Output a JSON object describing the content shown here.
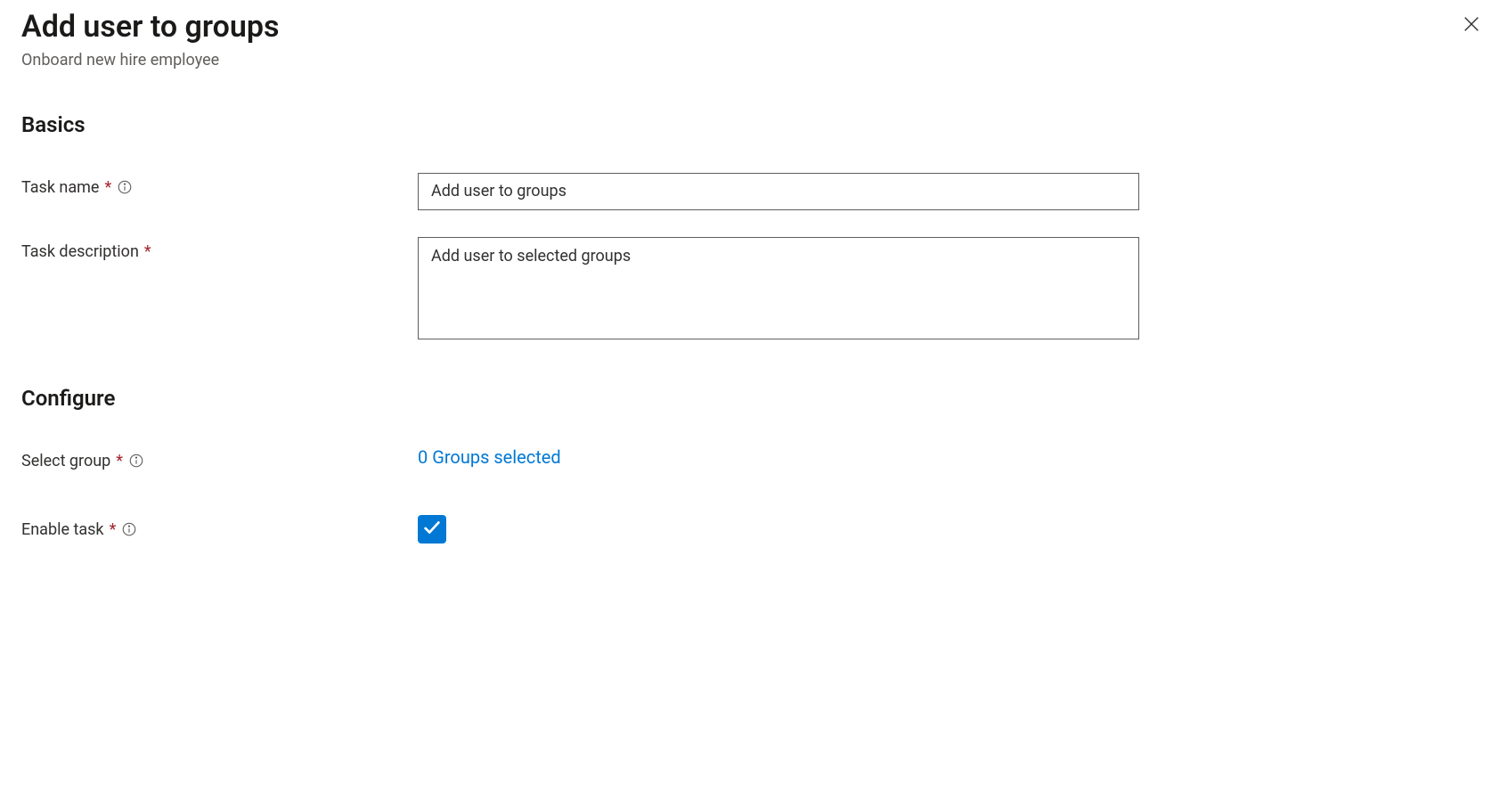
{
  "header": {
    "title": "Add user to groups",
    "subtitle": "Onboard new hire employee"
  },
  "sections": {
    "basics_heading": "Basics",
    "configure_heading": "Configure"
  },
  "fields": {
    "task_name": {
      "label": "Task name",
      "value": "Add user to groups"
    },
    "task_description": {
      "label": "Task description",
      "value": "Add user to selected groups"
    },
    "select_group": {
      "label": "Select group",
      "link_text": "0 Groups selected"
    },
    "enable_task": {
      "label": "Enable task",
      "checked": true
    }
  }
}
